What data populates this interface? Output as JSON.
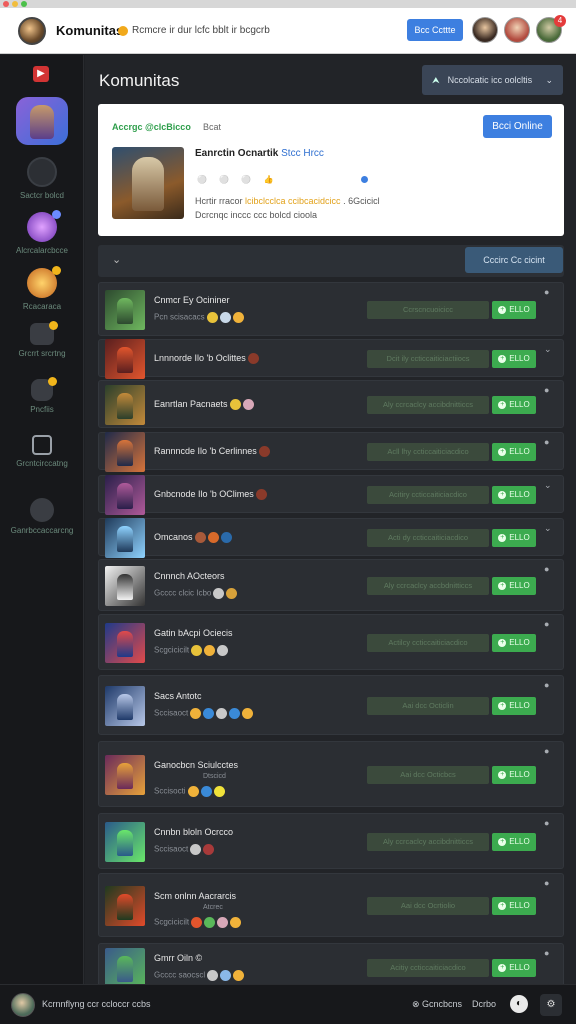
{
  "topbar": {
    "app_title": "Komunitas",
    "subtitle": "Rcmcre ir dur lcfc bblt ir bcgcrb",
    "button_label": "Bcc Ccttte",
    "notification_count": "4"
  },
  "sidebar": {
    "top_icon": "play-icon",
    "items": [
      {
        "label": "Sactcr bolcd",
        "icon": "basketball-icon"
      },
      {
        "label": "Alcrcalarcbcce",
        "icon": "galaxy-icon"
      },
      {
        "label": "Rcacaraca",
        "icon": "reward-icon"
      },
      {
        "label": "Grcrrt srcrtng",
        "icon": "chat-icon"
      },
      {
        "label": "Pncfiis",
        "icon": "shield-icon"
      },
      {
        "label": "Grcntcirccatng",
        "icon": "inbox-icon"
      },
      {
        "label": "Ganrbccaccarcng",
        "icon": "user-icon"
      }
    ]
  },
  "main": {
    "title": "Komunitas",
    "filter_label": "Nccolcatic icc oolcltis",
    "featured": {
      "heading": "Accrgc @clcBicco",
      "heading2": "Bcat",
      "button_label": "Bcci Online",
      "name": "Eanrctin Ocnartik",
      "name_highlight": "Stcc Hrcc",
      "stats": [
        "⚪",
        "⚪ ⚪",
        "👍"
      ],
      "desc_prefix": "Hcrtir rracor",
      "desc_highlight": "lcibclcclca ccibcacidcicc",
      "desc_suffix": ". 6Gcicicl",
      "desc_line2": "Dcrcnqc inccc ccc bolcd cioola"
    },
    "section_bar": {
      "toggle": "⌄",
      "button_label": "Cccirc Cc cicint"
    },
    "rows": [
      {
        "title": "Cnmcr Ey Ocininer",
        "sub": "Pcn scisacacs",
        "extra": "",
        "status": "Ccrscncuoicicc",
        "join": "ELLO",
        "more": "●"
      },
      {
        "title": "Lnnnorde Ilo 'b Oclittes",
        "sub": "",
        "extra": "",
        "status": "Dcit ily ccticcaiticiactiiocs",
        "join": "ELLO",
        "more": "⌄"
      },
      {
        "title": "Eanrtlan Pacnaets",
        "sub": "",
        "extra": "",
        "status": "Aly ccrcaclcy accibdnitticcs",
        "join": "ELLO",
        "more": "●"
      },
      {
        "title": "Rannncde Ilo 'b Cerlinnes",
        "sub": "",
        "extra": "",
        "status": "Acll lhy ccticcaiticiacdico",
        "join": "ELLO",
        "more": "●"
      },
      {
        "title": "Gnbcnode Ilo 'b OClimes",
        "sub": "",
        "extra": "",
        "status": "Acitiry ccticcaiticiacdico",
        "join": "ELLO",
        "more": "⌄"
      },
      {
        "title": "Omcanos",
        "sub": "",
        "extra": "",
        "status": "Acti dy ccticcaiticiacdico",
        "join": "ELLO",
        "more": "⌄"
      },
      {
        "title": "Cnnnch AOcteors",
        "sub": "Gcccc clcic Icbo",
        "extra": "",
        "status": "Aly ccrcaclcy accbdnitticcs",
        "join": "ELLO",
        "more": "●"
      },
      {
        "title": "Gatin bAcpi Ociecis",
        "sub": "Scgcicicilt",
        "extra": "",
        "status": "Actilcy ccticcaiticiacdico",
        "join": "ELLO",
        "more": "●"
      },
      {
        "title": "Sacs Antotc",
        "sub": "Sccisaoct",
        "extra": "",
        "status": "Aai dcc Octiclin",
        "join": "ELLO",
        "more": "●"
      },
      {
        "title": "Ganocbcn Sciulcctes",
        "sub": "Sccisocti",
        "extra": "Dtscicd",
        "status": "Aai dcc Octicbcs",
        "join": "ELLO",
        "more": "●"
      },
      {
        "title": "Cnnbn bloln Ocrcco",
        "sub": "Sccisaoct",
        "extra": "",
        "status": "Aly ccrcaclcy accibdnitticcs",
        "join": "ELLO",
        "more": "●"
      },
      {
        "title": "Scm onlnn Aacrarcis",
        "sub": "Scgcicicilt",
        "extra": "Atcrec",
        "status": "Aai dcc Ocrtiolio",
        "join": "ELLO",
        "more": "●"
      },
      {
        "title": "Gmrr Oiln ©",
        "sub": "Gcccc saocscl",
        "extra": "",
        "status": "Acitiy ccticcaiticiacdico",
        "join": "ELLO",
        "more": "●"
      }
    ]
  },
  "bottom": {
    "status_text": "Kcrnnflyng ccr ccloccr ccbs",
    "right_label1": "⊗ Gcncbcns",
    "right_label2": "Dcrbo"
  },
  "colors": {
    "accent_blue": "#3d7fe0",
    "join_green": "#3cab4f",
    "highlight_green": "#2e9e4b"
  }
}
